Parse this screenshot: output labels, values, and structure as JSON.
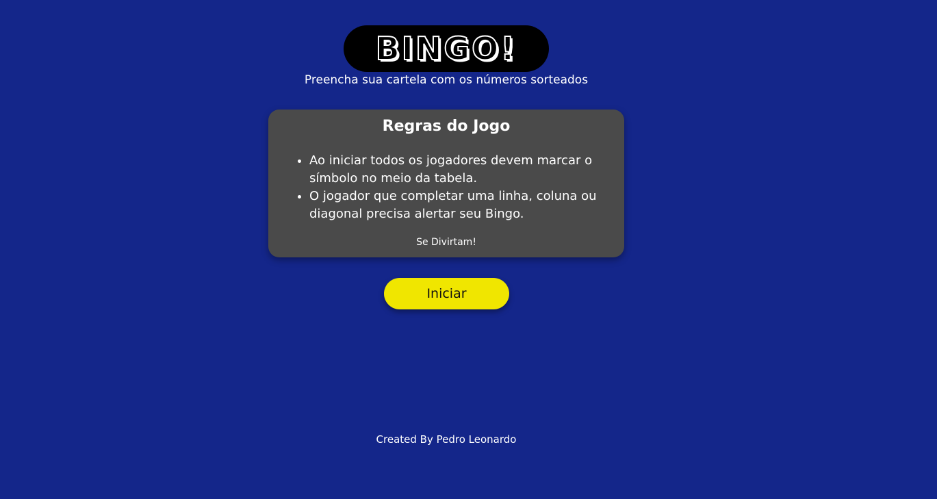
{
  "header": {
    "logo_text": "BINGO!",
    "subtitle": "Preencha sua cartela com os números sorteados"
  },
  "rules": {
    "title": "Regras do Jogo",
    "items": [
      "Ao iniciar todos os jogadores devem marcar o símbolo no meio da tabela.",
      "O jogador que completar uma linha, coluna ou diagonal precisa alertar seu Bingo."
    ],
    "footer": "Se Divirtam!"
  },
  "actions": {
    "start_label": "Iniciar"
  },
  "footer": {
    "credits": "Created By Pedro Leonardo"
  },
  "colors": {
    "background": "#14268a",
    "card": "#4a4a4a",
    "button": "#f0e600",
    "logo_pill": "#000000"
  }
}
